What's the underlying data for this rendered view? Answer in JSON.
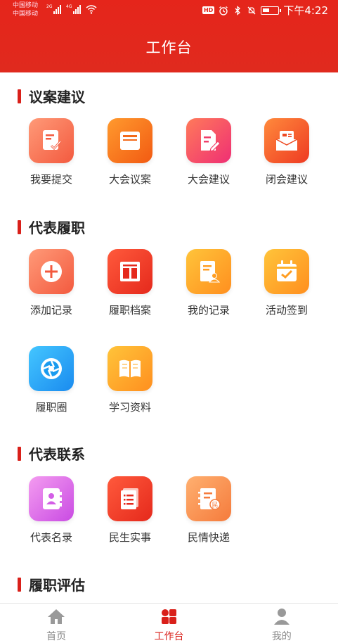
{
  "status": {
    "carrier1": "中国移动",
    "carrier2": "中国移动",
    "net1": "2G",
    "net2": "4G",
    "hd": "HD",
    "time": "下午4:22"
  },
  "header": {
    "title": "工作台"
  },
  "sections": [
    {
      "title": "议案建议",
      "items": [
        "我要提交",
        "大会议案",
        "大会建议",
        "闭会建议"
      ]
    },
    {
      "title": "代表履职",
      "items": [
        "添加记录",
        "履职档案",
        "我的记录",
        "活动签到",
        "履职圈",
        "学习资料"
      ]
    },
    {
      "title": "代表联系",
      "items": [
        "代表名录",
        "民生实事",
        "民情快递"
      ]
    },
    {
      "title": "履职评估",
      "items": []
    }
  ],
  "icon_glyphs": {
    "people": "民"
  },
  "tabs": [
    {
      "label": "首页",
      "icon": "home-icon"
    },
    {
      "label": "工作台",
      "icon": "grid-icon",
      "active": true
    },
    {
      "label": "我的",
      "icon": "person-icon"
    }
  ],
  "colors": {
    "brand": "#e5251b",
    "accent": "#d9201a"
  }
}
